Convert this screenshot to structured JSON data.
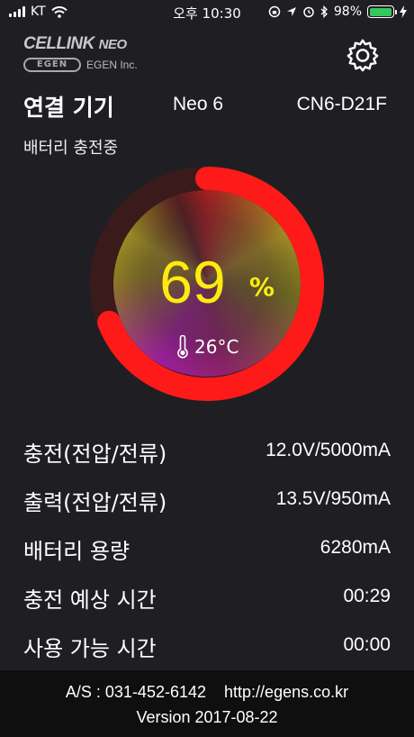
{
  "status_bar": {
    "carrier": "KT",
    "time": "오후 10:30",
    "battery_percent": "98%",
    "battery_level": 0.98,
    "icons": [
      "signal-icon",
      "wifi-icon",
      "rotation-lock-icon",
      "location-icon",
      "alarm-icon",
      "bluetooth-icon",
      "battery-icon",
      "charging-icon"
    ]
  },
  "brand": {
    "logo_text": "CELLINK",
    "logo_suffix": "NEO",
    "company_mark": "EGEN",
    "company_name": "EGEN Inc."
  },
  "header": {
    "settings_icon": "gear-icon"
  },
  "device": {
    "title": "연결 기기",
    "name": "Neo 6",
    "id": "CN6-D21F",
    "status": "배터리 충전중"
  },
  "gauge": {
    "percent_value": "69",
    "percent_unit": "%",
    "level": 0.69,
    "temperature": "26°C",
    "arc_color": "#ff1a1a",
    "track_color": "#3a1a1a",
    "percent_color": "#ffeb0f"
  },
  "info": [
    {
      "label": "충전(전압/전류)",
      "value": "12.0V/5000mA"
    },
    {
      "label": "출력(전압/전류)",
      "value": "13.5V/950mA"
    },
    {
      "label": "배터리 용량",
      "value": "6280mA"
    },
    {
      "label": "충전 예상 시간",
      "value": "00:29"
    },
    {
      "label": "사용 가능 시간",
      "value": "00:00"
    }
  ],
  "footer": {
    "as_phone": "A/S : 031-452-6142",
    "website": "http://egens.co.kr",
    "version": "Version 2017-08-22"
  }
}
